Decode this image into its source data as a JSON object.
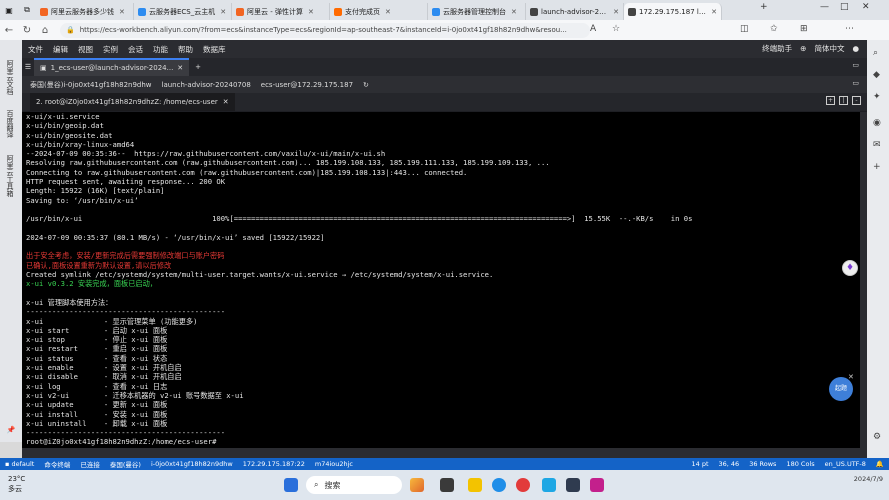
{
  "browser": {
    "tabs": [
      {
        "label": "阿里云服务器多少钱",
        "color": "#f26522"
      },
      {
        "label": "云服务器ECS_云主机",
        "color": "#2d8cf0"
      },
      {
        "label": "阿里云 - 弹性计算",
        "color": "#f26522"
      },
      {
        "label": "支付完成页",
        "color": "#ff6a00"
      },
      {
        "label": "云服务器管理控制台",
        "color": "#2d8cf0"
      },
      {
        "label": "launch-advisor-2024",
        "color": "#444"
      },
      {
        "label": "172.29.175.187 lau",
        "color": "#444",
        "active": true
      }
    ],
    "url": "https://ecs-workbench.aliyun.com/?from=ecs&instanceType=ecs&regionId=ap-southeast-7&instanceId=i-0jo0xt41gf18h82n9dhw&resou..."
  },
  "edge_sidebar": [
    "阿里云文档",
    "百度翻译",
    "阿里云工具箱"
  ],
  "workbench": {
    "menu": [
      "文件",
      "编辑",
      "视图",
      "实例",
      "会话",
      "功能",
      "帮助",
      "数据库"
    ],
    "menu_right": [
      "终端助手",
      "简体中文"
    ],
    "session_tab": "1_ecs-user@launch-advisor-2024...",
    "info": [
      "泰国(曼谷)i-0jo0xt41gf18h82n9dhw",
      "launch-advisor-20240708",
      "ecs-user@172.29.175.187"
    ],
    "terminal_tab": "2. root@iZ0jo0xt41gf18h82n9dhzZ: /home/ecs-user"
  },
  "terminal_lines": [
    {
      "t": "x-ui/x-ui.service",
      "c": ""
    },
    {
      "t": "x-ui/bin/geoip.dat",
      "c": ""
    },
    {
      "t": "x-ui/bin/geosite.dat",
      "c": ""
    },
    {
      "t": "x-ui/bin/xray-linux-amd64",
      "c": ""
    },
    {
      "t": "--2024-07-09 00:35:36--  https://raw.githubusercontent.com/vaxilu/x-ui/main/x-ui.sh",
      "c": ""
    },
    {
      "t": "Resolving raw.githubusercontent.com (raw.githubusercontent.com)... 185.199.108.133, 185.199.111.133, 185.199.109.133, ...",
      "c": ""
    },
    {
      "t": "Connecting to raw.githubusercontent.com (raw.githubusercontent.com)|185.199.108.133|:443... connected.",
      "c": ""
    },
    {
      "t": "HTTP request sent, awaiting response... 200 OK",
      "c": ""
    },
    {
      "t": "Length: 15922 (16K) [text/plain]",
      "c": ""
    },
    {
      "t": "Saving to: ‘/usr/bin/x-ui’",
      "c": ""
    },
    {
      "t": "",
      "c": ""
    },
    {
      "t": "/usr/bin/x-ui                              100%[=============================================================================>]  15.55K  --.-KB/s    in 0s",
      "c": ""
    },
    {
      "t": "",
      "c": ""
    },
    {
      "t": "2024-07-09 00:35:37 (80.1 MB/s) - ‘/usr/bin/x-ui’ saved [15922/15922]",
      "c": ""
    },
    {
      "t": "",
      "c": ""
    },
    {
      "t": "出于安全考虑，安装/更新完成后需要强制修改端口与账户密码",
      "c": "red"
    },
    {
      "t": "已确认,面板设置重新为默认设置,请以后修改",
      "c": "red"
    },
    {
      "t": "Created symlink /etc/systemd/system/multi-user.target.wants/x-ui.service → /etc/systemd/system/x-ui.service.",
      "c": ""
    },
    {
      "t": "x-ui v0.3.2 安装完成，面板已启动，",
      "c": "grn"
    },
    {
      "t": "",
      "c": ""
    },
    {
      "t": "x-ui 管理脚本使用方法：",
      "c": ""
    },
    {
      "t": "----------------------------------------------",
      "c": ""
    },
    {
      "t": "x-ui              - 显示管理菜单 (功能更多)",
      "c": ""
    },
    {
      "t": "x-ui start        - 启动 x-ui 面板",
      "c": ""
    },
    {
      "t": "x-ui stop         - 停止 x-ui 面板",
      "c": ""
    },
    {
      "t": "x-ui restart      - 重启 x-ui 面板",
      "c": ""
    },
    {
      "t": "x-ui status       - 查看 x-ui 状态",
      "c": ""
    },
    {
      "t": "x-ui enable       - 设置 x-ui 开机自启",
      "c": ""
    },
    {
      "t": "x-ui disable      - 取消 x-ui 开机自启",
      "c": ""
    },
    {
      "t": "x-ui log          - 查看 x-ui 日志",
      "c": ""
    },
    {
      "t": "x-ui v2-ui        - 迁移本机器的 v2-ui 账号数据至 x-ui",
      "c": ""
    },
    {
      "t": "x-ui update       - 更新 x-ui 面板",
      "c": ""
    },
    {
      "t": "x-ui install      - 安装 x-ui 面板",
      "c": ""
    },
    {
      "t": "x-ui uninstall    - 卸载 x-ui 面板",
      "c": ""
    },
    {
      "t": "----------------------------------------------",
      "c": ""
    },
    {
      "t": "root@iZ0jo0xt41gf18h82n9dhzZ:/home/ecs-user#",
      "c": ""
    }
  ],
  "bluebar": {
    "left": [
      "default",
      "命令终端",
      "已连接",
      "泰国(曼谷)",
      "i-0jo0xt41gf18h82n9dhw",
      "172.29.175.187:22",
      "m74iou2hjc"
    ],
    "right": [
      "14 pt",
      "36, 46",
      "36 Rows",
      "180 Cols",
      "en_US.UTF-8"
    ]
  },
  "overlay": {
    "float_label": "起题"
  },
  "taskbar": {
    "weather_temp": "23°C",
    "weather_desc": "多云",
    "search_placeholder": "搜索",
    "time": "",
    "date": "2024/7/9"
  }
}
